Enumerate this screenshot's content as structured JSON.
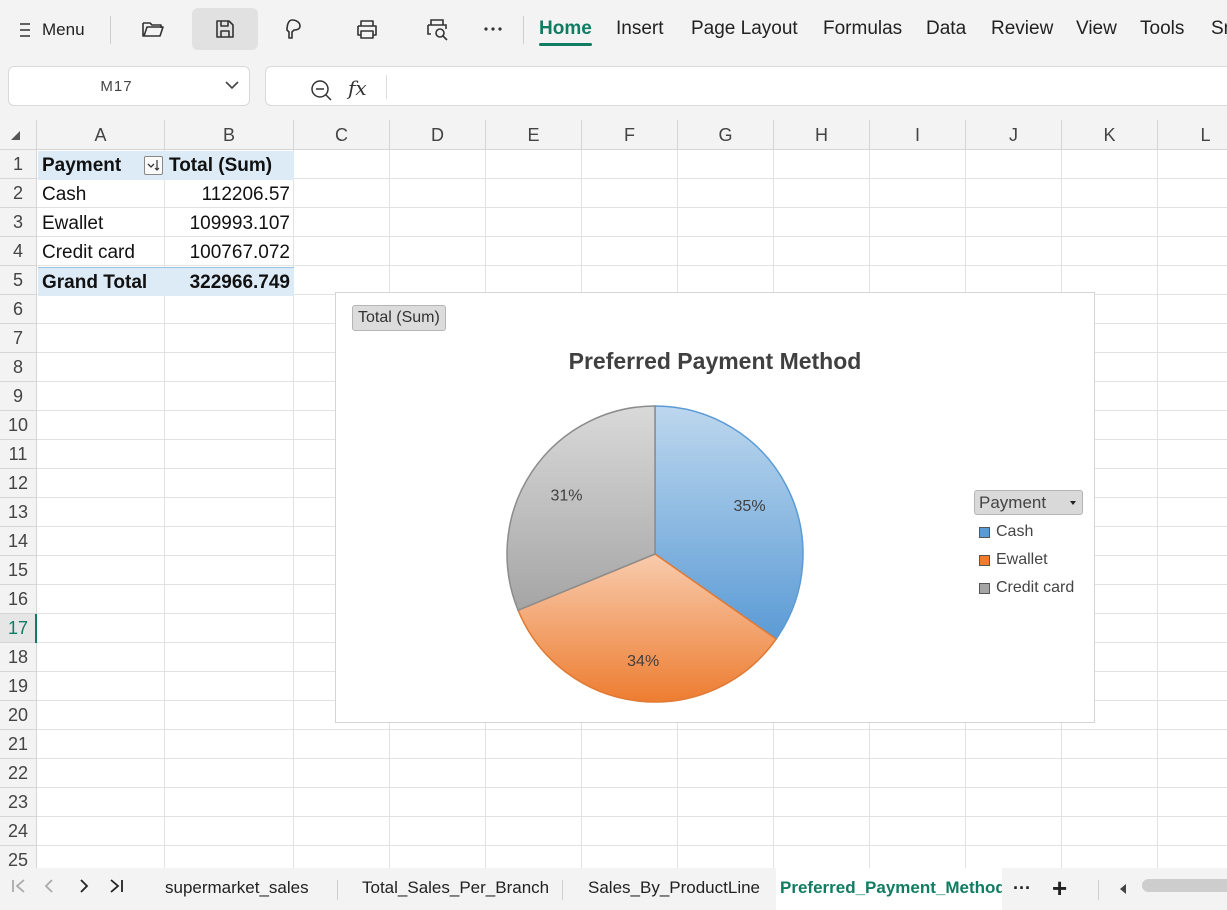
{
  "toolbar": {
    "menu_label": "Menu",
    "tabs": [
      {
        "label": "Home",
        "active": true
      },
      {
        "label": "Insert"
      },
      {
        "label": "Page Layout"
      },
      {
        "label": "Formulas"
      },
      {
        "label": "Data"
      },
      {
        "label": "Review"
      },
      {
        "label": "View"
      },
      {
        "label": "Tools"
      },
      {
        "label": "Sm"
      }
    ],
    "icons": [
      "menu-icon",
      "open-folder-icon",
      "save-icon",
      "format-painter-icon",
      "print-icon",
      "print-preview-icon",
      "more-icon"
    ],
    "accent_color": "#107c62"
  },
  "formula_bar": {
    "name_box": "M17",
    "fx_label": "fx",
    "formula": ""
  },
  "grid": {
    "columns": [
      "A",
      "B",
      "C",
      "D",
      "E",
      "F",
      "G",
      "H",
      "I",
      "J",
      "K",
      "L"
    ],
    "rows": [
      "1",
      "2",
      "3",
      "4",
      "5",
      "6",
      "7",
      "8",
      "9",
      "10",
      "11",
      "12",
      "13",
      "14",
      "15",
      "16",
      "17",
      "18",
      "19",
      "20",
      "21",
      "22",
      "23",
      "24",
      "25"
    ],
    "selected_row": "17"
  },
  "pivot": {
    "header_payment": "Payment",
    "header_total": "Total (Sum)",
    "rows": [
      {
        "label": "Cash",
        "value": "112206.57"
      },
      {
        "label": "Ewallet",
        "value": "109993.107"
      },
      {
        "label": "Credit card",
        "value": "100767.072"
      }
    ],
    "grand_total_label": "Grand Total",
    "grand_total_value": "322966.749"
  },
  "chart": {
    "field_button": "Total (Sum)",
    "legend_button": "Payment"
  },
  "chart_data": {
    "type": "pie",
    "title": "Preferred Payment Method",
    "categories": [
      "Cash",
      "Ewallet",
      "Credit card"
    ],
    "values": [
      112206.57,
      109993.107,
      100767.072
    ],
    "data_labels": [
      "35%",
      "34%",
      "31%"
    ],
    "colors": [
      "#5b9bd5",
      "#ed7d31",
      "#a5a5a5"
    ],
    "legend_position": "right"
  },
  "sheets": {
    "tabs": [
      {
        "label": "supermarket_sales"
      },
      {
        "label": "Total_Sales_Per_Branch"
      },
      {
        "label": "Sales_By_ProductLine"
      },
      {
        "label": "Preferred_Payment_Method",
        "active": true
      }
    ],
    "more_label": "···",
    "add_label": "+"
  }
}
